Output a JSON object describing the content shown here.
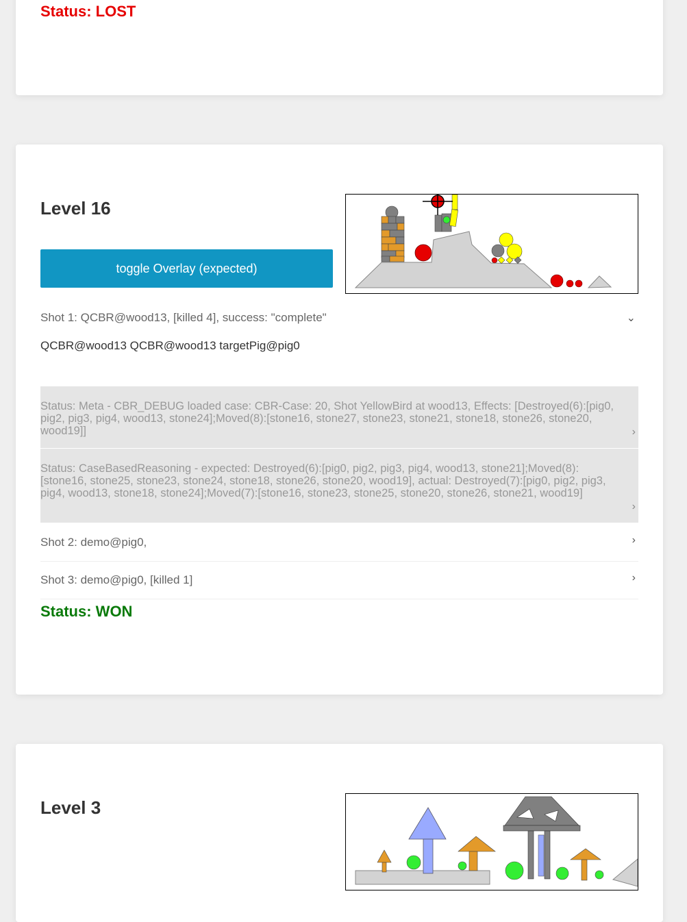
{
  "prev_card": {
    "status": "Status: LOST"
  },
  "level16": {
    "title": "Level 16",
    "toggle_label": "toggle Overlay (expected)",
    "shots": [
      {
        "label": "Shot 1: QCBR@wood13, [killed 4], success: \"complete\"",
        "expanded": true
      },
      {
        "label": "Shot 2: demo@pig0,",
        "expanded": false
      },
      {
        "label": "Shot 3: demo@pig0, [killed 1]",
        "expanded": false
      }
    ],
    "shot1_targets": "QCBR@wood13 QCBR@wood13 targetPig@pig0",
    "status_messages": [
      "Status: Meta - CBR_DEBUG loaded case: CBR-Case: 20, Shot YellowBird at wood13, Effects: [Destroyed(6):[pig0, pig2, pig3, pig4, wood13, stone24];Moved(8):[stone16, stone27, stone23, stone21, stone18, stone26, stone20, wood19]]",
      "Status: CaseBasedReasoning - expected: Destroyed(6):[pig0, pig2, pig3, pig4, wood13, stone21];Moved(8):[stone16, stone25, stone23, stone24, stone18, stone26, stone20, wood19], actual: Destroyed(7):[pig0, pig2, pig3, pig4, wood13, stone18, stone24];Moved(7):[stone16, stone23, stone25, stone20, stone26, stone21, wood19]"
    ],
    "result": "Status: WON"
  },
  "level3": {
    "title": "Level 3"
  },
  "colors": {
    "accent": "#1196c3",
    "lost": "#e60000",
    "won": "#0a7a0a"
  }
}
